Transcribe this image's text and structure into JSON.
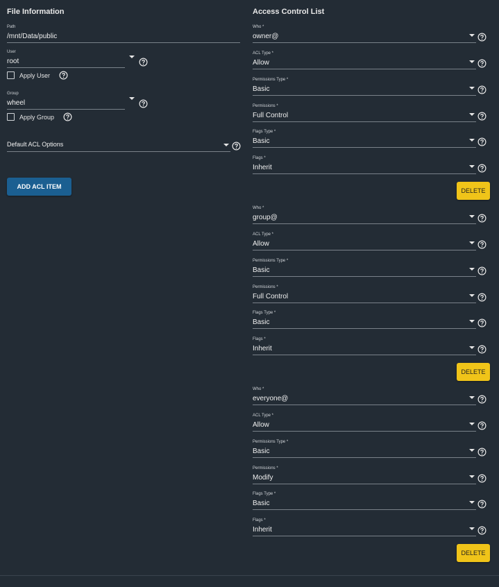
{
  "file_info": {
    "title": "File Information",
    "path": {
      "label": "Path",
      "value": "/mnt/Data/public"
    },
    "user": {
      "label": "User",
      "value": "root",
      "apply_label": "Apply User"
    },
    "group": {
      "label": "Group",
      "value": "wheel",
      "apply_label": "Apply Group"
    },
    "default_acl": {
      "label": "Default ACL Options"
    },
    "add_button": "ADD ACL ITEM"
  },
  "acl": {
    "title": "Access Control List",
    "delete_label": "DELETE",
    "items": [
      {
        "who": {
          "label": "Who *",
          "value": "owner@"
        },
        "acl_type": {
          "label": "ACL Type *",
          "value": "Allow"
        },
        "perm_type": {
          "label": "Permissions Type *",
          "value": "Basic"
        },
        "perms": {
          "label": "Permissions *",
          "value": "Full Control"
        },
        "flags_type": {
          "label": "Flags Type *",
          "value": "Basic"
        },
        "flags": {
          "label": "Flags *",
          "value": "Inherit"
        }
      },
      {
        "who": {
          "label": "Who *",
          "value": "group@"
        },
        "acl_type": {
          "label": "ACL Type *",
          "value": "Allow"
        },
        "perm_type": {
          "label": "Permissions Type *",
          "value": "Basic"
        },
        "perms": {
          "label": "Permissions *",
          "value": "Full Control"
        },
        "flags_type": {
          "label": "Flags Type *",
          "value": "Basic"
        },
        "flags": {
          "label": "Flags *",
          "value": "Inherit"
        }
      },
      {
        "who": {
          "label": "Who *",
          "value": "everyone@"
        },
        "acl_type": {
          "label": "ACL Type *",
          "value": "Allow"
        },
        "perm_type": {
          "label": "Permissions Type *",
          "value": "Basic"
        },
        "perms": {
          "label": "Permissions *",
          "value": "Modify"
        },
        "flags_type": {
          "label": "Flags Type *",
          "value": "Basic"
        },
        "flags": {
          "label": "Flags *",
          "value": "Inherit"
        }
      }
    ]
  },
  "icons": {
    "help": "help-circle-icon",
    "dropdown": "chevron-down-icon",
    "checkbox": "checkbox-unchecked-icon"
  },
  "colors": {
    "background": "#232c35",
    "primary_button": "#1b5f91",
    "delete_button": "#f0c419",
    "underline": "#7a828a"
  }
}
